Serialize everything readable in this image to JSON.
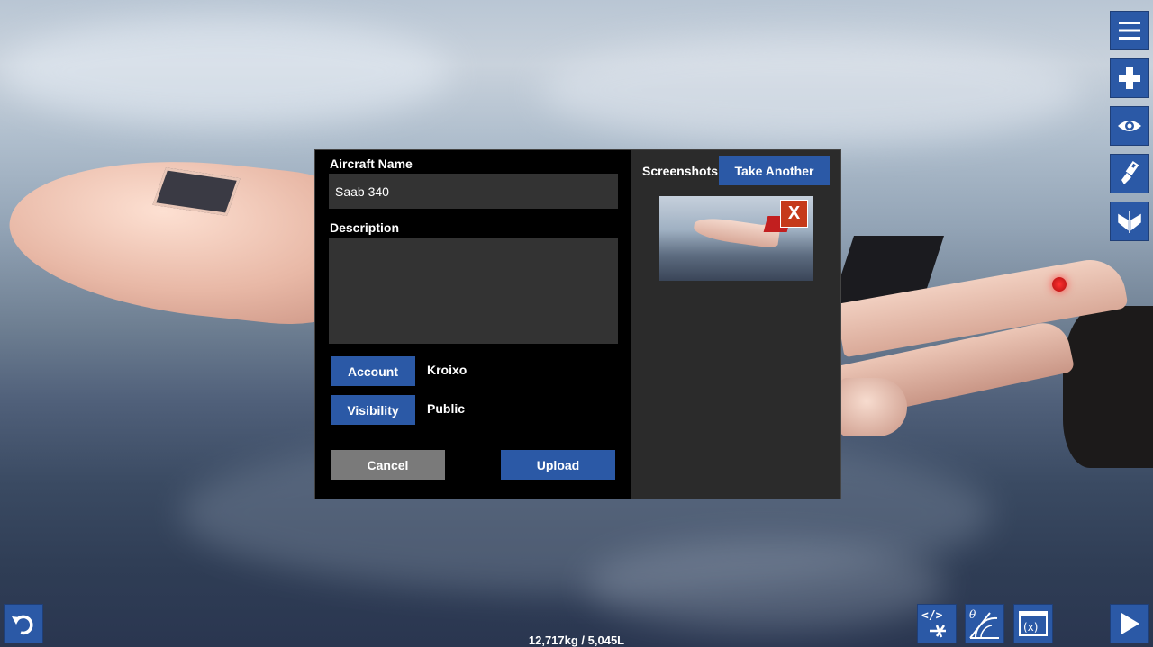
{
  "dialog": {
    "aircraft_name_label": "Aircraft Name",
    "aircraft_name_value": "Saab 340",
    "description_label": "Description",
    "description_value": "",
    "account_button": "Account",
    "account_value": "Kroixo",
    "visibility_button": "Visibility",
    "visibility_value": "Public",
    "cancel_button": "Cancel",
    "upload_button": "Upload",
    "screenshots_label": "Screenshots",
    "take_another_button": "Take Another",
    "remove_screenshot": "X"
  },
  "toolbar": {
    "icons": [
      "menu-icon",
      "add-part-icon",
      "view-icon",
      "paint-icon",
      "symmetry-icon"
    ]
  },
  "bottom": {
    "status": "12,717kg / 5,045L",
    "icons": [
      "undo-icon",
      "xml-edit-icon",
      "angle-tool-icon",
      "variables-icon",
      "play-icon"
    ]
  },
  "colors": {
    "accent": "#2b59a6",
    "close": "#c63a1a",
    "panel": "#000000",
    "panel_right": "#2b2b2b",
    "field": "#333333",
    "cancel": "#7a7a7a"
  }
}
